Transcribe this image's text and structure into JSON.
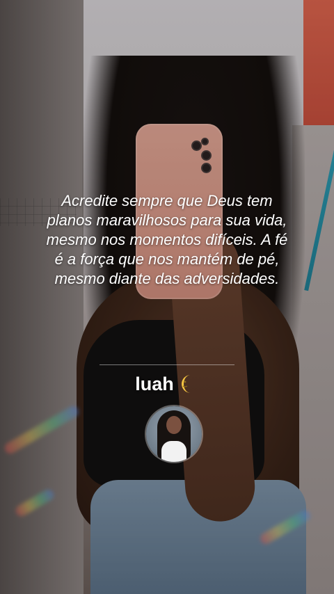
{
  "overlay": {
    "quote_lines": [
      "Acredite sempre que Deus tem",
      "planos maravilhosos para sua vida,",
      "mesmo nos momentos difíceis. A fé",
      "é a força que nos mantém de pé,",
      "mesmo diante das adversidades."
    ],
    "username": "luah",
    "username_emoji": "moon-icon",
    "avatar_icon": "profile-avatar"
  },
  "colors": {
    "text": "#ffffff",
    "divider": "#ffffff",
    "moon": "#f5c542"
  }
}
